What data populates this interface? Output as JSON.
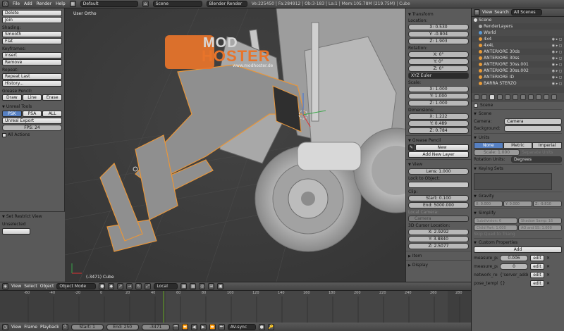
{
  "menubar": {
    "menus": [
      "File",
      "Add",
      "Render",
      "Help"
    ],
    "layout": "Default",
    "scene": "Scene",
    "engine": "Blender Render",
    "stats": "Ve:225450 | Fa:284912 | Ob:3-183 | La:1 | Mem:105.78M (219.75M) | Cube"
  },
  "toolshelf": {
    "top_buttons": [
      "Delete",
      "Join"
    ],
    "shading_label": "Shading:",
    "shading_buttons": [
      "Smooth",
      "Flat"
    ],
    "keyframes_label": "Keyframes:",
    "keyframes_buttons": [
      "Insert",
      "Remove"
    ],
    "repeat_label": "Repeat:",
    "repeat_buttons": [
      "Repeat Last",
      "History..."
    ],
    "grease_label": "Grease Pencil:",
    "grease_buttons": [
      "Draw",
      "Line",
      "Erase"
    ],
    "unreal_header": "Unreal Tools",
    "unreal_tabs": [
      "PSK",
      "PSA",
      "ALL"
    ],
    "unreal_export": "Unreal Export",
    "fps": "FPS: 24",
    "all_actions": "All Actions",
    "restrict_header": "Set Restrict View",
    "restrict_btn": "Unselected"
  },
  "viewport": {
    "view_label": "User Ortho",
    "object_label": "(-3471) Cube",
    "watermark_top": "MOD",
    "watermark_bottom": "HOSTER",
    "watermark_url": "www.modhoster.de"
  },
  "npanel": {
    "transform": "Transform",
    "location_label": "Location:",
    "location": [
      "X: 0.530",
      "Y: -0.804",
      "Z: 1.903"
    ],
    "rotation_label": "Rotation:",
    "rotation": [
      "X: 0°",
      "Y: 0°",
      "Z: 0°"
    ],
    "rotation_mode": "XYZ Euler",
    "scale_label": "Scale:",
    "scale": [
      "X: 1.000",
      "Y: 1.000",
      "Z: 1.000"
    ],
    "dimensions_label": "Dimensions:",
    "dimensions": [
      "X: 1.222",
      "Y: 0.489",
      "Z: 0.784"
    ],
    "grease_pencil": "Grease Pencil",
    "new_btn": "New",
    "add_new_layer": "Add New Layer",
    "view": "View",
    "lens": "Lens: 1.000",
    "lock_to_object": "Lock to Object:",
    "clip_label": "Clip:",
    "clip_start": "Start: 0.100",
    "clip_end": "End: 5000.000",
    "local_camera": "Local Camera:",
    "camera": "Camera",
    "cursor_label": "3D Cursor Location:",
    "cursor": [
      "X: 2.9292",
      "Y: 3.8840",
      "Z: 2.5077"
    ],
    "item": "Item",
    "display": "Display"
  },
  "outliner": {
    "view_menu": "View",
    "search_menu": "Search",
    "filter": "All Scenes",
    "items": [
      {
        "name": "Scene",
        "indent": 0
      },
      {
        "name": "RenderLayers",
        "indent": 1
      },
      {
        "name": "World",
        "indent": 1
      },
      {
        "name": "4x4",
        "indent": 1
      },
      {
        "name": "4x4L",
        "indent": 1
      },
      {
        "name": "ANTERIORE 30ds",
        "indent": 1
      },
      {
        "name": "ANTERIORE 30ss",
        "indent": 1
      },
      {
        "name": "ANTERIORE 30ss.001",
        "indent": 1
      },
      {
        "name": "ANTERIORE 30ss.002",
        "indent": 1
      },
      {
        "name": "ANTERIORE ID",
        "indent": 1
      },
      {
        "name": "BARRA STERZO",
        "indent": 1
      }
    ]
  },
  "props": {
    "breadcrumb": "Scene",
    "scene_section": "Scene",
    "camera_label": "Camera:",
    "camera_value": "Camera",
    "background_label": "Background:",
    "units_section": "Units",
    "unit_tabs": [
      "None",
      "Metric",
      "Imperial"
    ],
    "scale_field": "Scale: 1.000",
    "separate_units": "Separate Units",
    "rotation_units_label": "Rotation Units:",
    "rotation_units_value": "Degrees",
    "keying_sets": "Keying Sets",
    "gravity_section": "Gravity",
    "gravity": [
      "X: 0.000",
      "Y: 0.000",
      "Z: -9.810"
    ],
    "simplify_section": "Simplify",
    "subdivision": "Subdivision: 6",
    "shadow_samples": "Shadow Samp: 16",
    "child_particles": "Child Part: 1.000",
    "ao_sss": "AO and SS: 1.000",
    "skip_quad": "Skip Quad to Triang",
    "custom_props": "Custom Properties",
    "add_btn": "Add",
    "custom_rows": [
      {
        "name": "measure_panel",
        "value": "0.006"
      },
      {
        "name": "measure_panel",
        "value": "0"
      },
      {
        "name": "network_rende",
        "value": "{'server_addre"
      },
      {
        "name": "pose_template",
        "value": "{}"
      }
    ],
    "edit_label": "edit"
  },
  "vpheader": {
    "menus": [
      "View",
      "Select",
      "Object"
    ],
    "mode": "Object Mode",
    "orientation": "Local"
  },
  "timeline": {
    "ticks": [
      "-60",
      "-40",
      "-20",
      "0",
      "20",
      "40",
      "60",
      "80",
      "100",
      "120",
      "140",
      "160",
      "180",
      "200",
      "220",
      "240",
      "260",
      "280"
    ],
    "menus": [
      "View",
      "Frame",
      "Playback"
    ],
    "start": "Start: 1",
    "end": "End: 250",
    "current": "-3471",
    "sync": "AV-sync"
  }
}
